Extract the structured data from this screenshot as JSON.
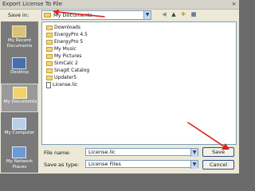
{
  "window": {
    "title": "Export License To File",
    "close_glyph": "×"
  },
  "save_in": {
    "label": "Save in:",
    "value": "My Documents"
  },
  "toolbar": {
    "back_icon": "back-arrow-icon",
    "up_icon": "up-folder-icon",
    "new_folder_icon": "new-folder-icon",
    "views_icon": "views-menu-icon"
  },
  "places": [
    {
      "label": "My Recent Documents",
      "icon": "recent-documents-icon",
      "selected": false
    },
    {
      "label": "Desktop",
      "icon": "desktop-icon",
      "selected": false
    },
    {
      "label": "My Documents",
      "icon": "my-documents-icon",
      "selected": true
    },
    {
      "label": "My Computer",
      "icon": "my-computer-icon",
      "selected": false
    },
    {
      "label": "My Network Places",
      "icon": "network-places-icon",
      "selected": false
    }
  ],
  "files": [
    {
      "name": "Downloads",
      "type": "folder"
    },
    {
      "name": "EnergyPro 4.5",
      "type": "folder"
    },
    {
      "name": "EnergyPro 5",
      "type": "folder"
    },
    {
      "name": "My Music",
      "type": "folder"
    },
    {
      "name": "My Pictures",
      "type": "folder"
    },
    {
      "name": "SimCalc 2",
      "type": "folder"
    },
    {
      "name": "SnagIt Catalog",
      "type": "folder"
    },
    {
      "name": "Updater5",
      "type": "folder"
    },
    {
      "name": "License.lic",
      "type": "file"
    }
  ],
  "file_name": {
    "label": "File name:",
    "value": "License.lic"
  },
  "save_as_type": {
    "label": "Save as type:",
    "value": "License Files"
  },
  "buttons": {
    "save": "Save",
    "cancel": "Cancel"
  },
  "colors": {
    "annotation_arrow": "#e0201a",
    "dialog_bg": "#ece9d8",
    "places_bg": "#7a7a7a"
  }
}
